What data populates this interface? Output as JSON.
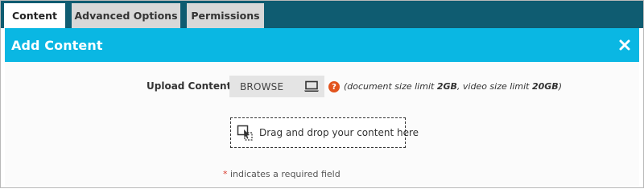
{
  "tabs": [
    {
      "label": "Content",
      "active": true
    },
    {
      "label": "Advanced Options",
      "active": false
    },
    {
      "label": "Permissions",
      "active": false
    }
  ],
  "header": {
    "title": "Add Content",
    "close_icon": "close-icon"
  },
  "upload": {
    "label": "Upload Content",
    "required_marker": "*",
    "browse_label": "BROWSE",
    "browse_icon": "laptop-icon",
    "help_icon": "question-icon",
    "help_glyph": "?",
    "note_prefix": "(document size limit ",
    "doc_limit": "2GB",
    "note_middle": ", video size limit ",
    "video_limit": "20GB",
    "note_suffix": ")"
  },
  "dropzone": {
    "text": "Drag and drop your content here",
    "icon": "drag-drop-icon"
  },
  "footer": {
    "required_marker": "*",
    "required_note": " indicates a required field"
  },
  "colors": {
    "tabbar_bg": "#0f5c71",
    "header_bg": "#0ab7e3",
    "required": "#d9392b",
    "help_icon": "#e2541e"
  }
}
